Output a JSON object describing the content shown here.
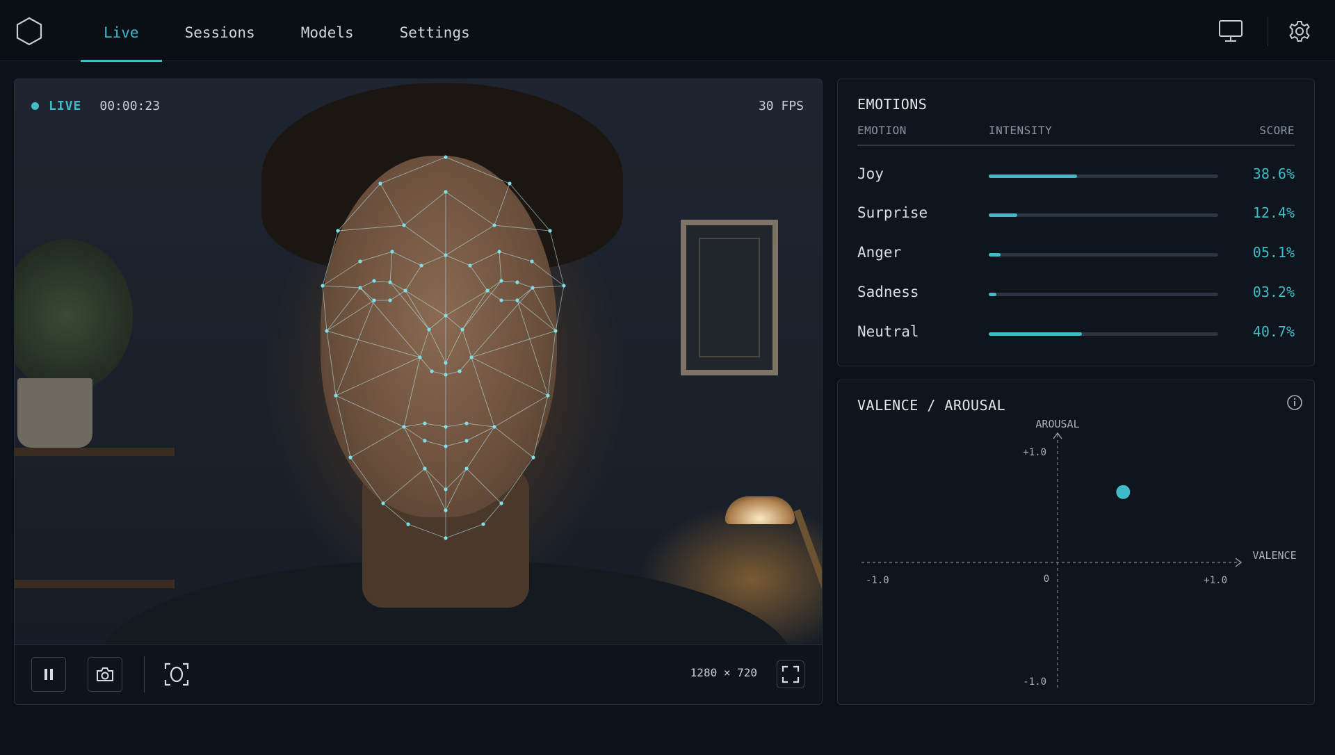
{
  "nav": {
    "tabs": [
      {
        "label": "Live",
        "active": true
      },
      {
        "label": "Sessions",
        "active": false
      },
      {
        "label": "Models",
        "active": false
      },
      {
        "label": "Settings",
        "active": false
      }
    ],
    "logo_icon": "hexagon-icon",
    "right_icons": [
      "monitor-icon",
      "gear-icon"
    ]
  },
  "video": {
    "status": "LIVE",
    "timer": "00:00:23",
    "fps": "30 FPS",
    "resolution": "1280 × 720",
    "controls": [
      "pause-icon",
      "camera-icon",
      "face-scan-icon",
      "fullscreen-icon"
    ]
  },
  "emotions": {
    "title": "EMOTIONS",
    "columns": [
      "EMOTION",
      "INTENSITY",
      "SCORE"
    ],
    "rows": [
      {
        "name": "Joy",
        "score": "38.6%",
        "value": 0.386
      },
      {
        "name": "Surprise",
        "score": "12.4%",
        "value": 0.124
      },
      {
        "name": "Anger",
        "score": "05.1%",
        "value": 0.051
      },
      {
        "name": "Sadness",
        "score": "03.2%",
        "value": 0.032
      },
      {
        "name": "Neutral",
        "score": "40.7%",
        "value": 0.407
      }
    ]
  },
  "valence_arousal": {
    "title": "VALENCE / AROUSAL",
    "x_label": "VALENCE",
    "y_label": "AROUSAL",
    "x_min_label": "-1.0",
    "x_max_label": "+1.0",
    "y_min_label": "-1.0",
    "y_max_label": "+1.0",
    "origin_label": "0"
  },
  "chart_data": {
    "type": "scatter",
    "title": "VALENCE / AROUSAL",
    "xlabel": "VALENCE",
    "ylabel": "AROUSAL",
    "xlim": [
      -1,
      1
    ],
    "ylim": [
      -1,
      1
    ],
    "points": [
      {
        "x": 0.36,
        "y": 0.55
      }
    ],
    "colors": {
      "point": "#3fbcc8",
      "axes": "#6b7684"
    }
  },
  "colors": {
    "accent": "#3fbcc8",
    "background": "#0b1119"
  }
}
